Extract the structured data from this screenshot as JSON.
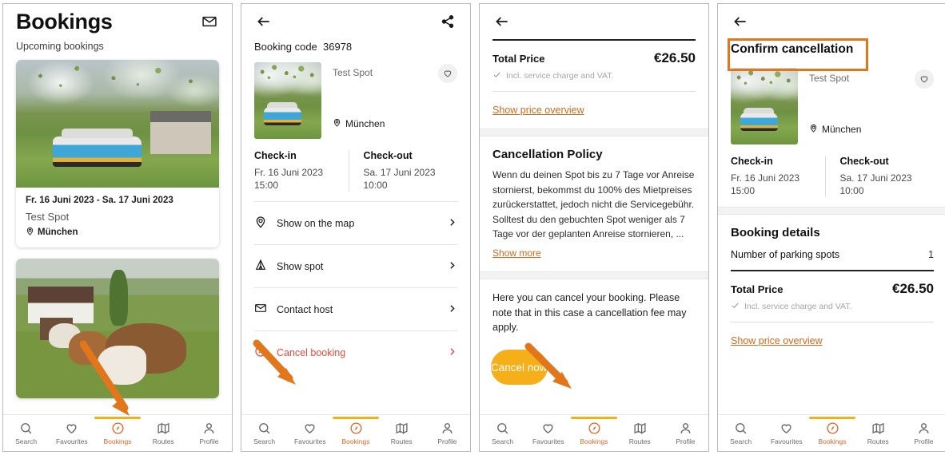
{
  "theme": {
    "accent_orange": "#e0672a",
    "button_amber": "#F5AF19",
    "link_orange": "#d2691e",
    "danger_red": "#f0493c",
    "annotation_orange": "#E2761B"
  },
  "nav": {
    "items": [
      {
        "label": "Search",
        "icon": "search-icon",
        "active": false
      },
      {
        "label": "Favourites",
        "icon": "heart-icon",
        "active": false
      },
      {
        "label": "Bookings",
        "icon": "compass-icon",
        "active": true
      },
      {
        "label": "Routes",
        "icon": "map-icon",
        "active": false
      },
      {
        "label": "Profile",
        "icon": "person-icon",
        "active": false
      }
    ]
  },
  "screen1": {
    "title": "Bookings",
    "mail_icon": "envelope-icon",
    "section_label": "Upcoming bookings",
    "cards": [
      {
        "dates": "Fr. 16 Juni 2023 - Sa. 17 Juni 2023",
        "spot_name": "Test Spot",
        "city": "München",
        "photo": "campervan-under-blossom-tree"
      },
      {
        "photo": "alpacas-in-meadow"
      }
    ]
  },
  "screen2": {
    "back_icon": "arrow-left-icon",
    "share_icon": "share-icon",
    "booking_code_label": "Booking code",
    "booking_code_value": "36978",
    "spot_name": "Test Spot",
    "city": "München",
    "favourite_icon": "heart-outline-icon",
    "checkin_label": "Check-in",
    "checkin_date": "Fr. 16 Juni 2023",
    "checkin_time": "15:00",
    "checkout_label": "Check-out",
    "checkout_date": "Sa. 17 Juni 2023",
    "checkout_time": "10:00",
    "menu": [
      {
        "label": "Show on the map",
        "icon": "location-pin-icon",
        "danger": false
      },
      {
        "label": "Show spot",
        "icon": "tent-icon",
        "danger": false
      },
      {
        "label": "Contact host",
        "icon": "envelope-icon",
        "danger": false
      },
      {
        "label": "Cancel booking",
        "icon": "cancel-circle-icon",
        "danger": true
      }
    ]
  },
  "screen3": {
    "back_icon": "arrow-left-icon",
    "total_price_label": "Total Price",
    "total_price_value": "€26.50",
    "price_note": "Incl. service charge and VAT.",
    "price_overview_link": "Show price overview",
    "policy_title": "Cancellation Policy",
    "policy_text": "Wenn du deinen Spot bis zu 7 Tage vor Anreise stornierst, bekommst du 100% des Mietpreises zurückerstattet, jedoch nicht die Servicegebühr. Solltest du den gebuchten Spot weniger als 7 Tage vor der geplanten Anreise stornieren, ...",
    "show_more_link": "Show more",
    "cancel_note": "Here you can cancel your booking. Please note that in this case a cancellation fee may apply.",
    "cancel_button": "Cancel now"
  },
  "screen4": {
    "back_icon": "arrow-left-icon",
    "title": "Confirm cancellation",
    "spot_name": "Test Spot",
    "city": "München",
    "favourite_icon": "heart-outline-icon",
    "checkin_label": "Check-in",
    "checkin_date": "Fr. 16 Juni 2023",
    "checkin_time": "15:00",
    "checkout_label": "Check-out",
    "checkout_date": "Sa. 17 Juni 2023",
    "checkout_time": "10:00",
    "details_title": "Booking details",
    "spots_label": "Number of parking spots",
    "spots_value": "1",
    "total_price_label": "Total Price",
    "total_price_value": "€26.50",
    "price_note": "Incl. service charge and VAT.",
    "price_overview_link": "Show price overview"
  }
}
